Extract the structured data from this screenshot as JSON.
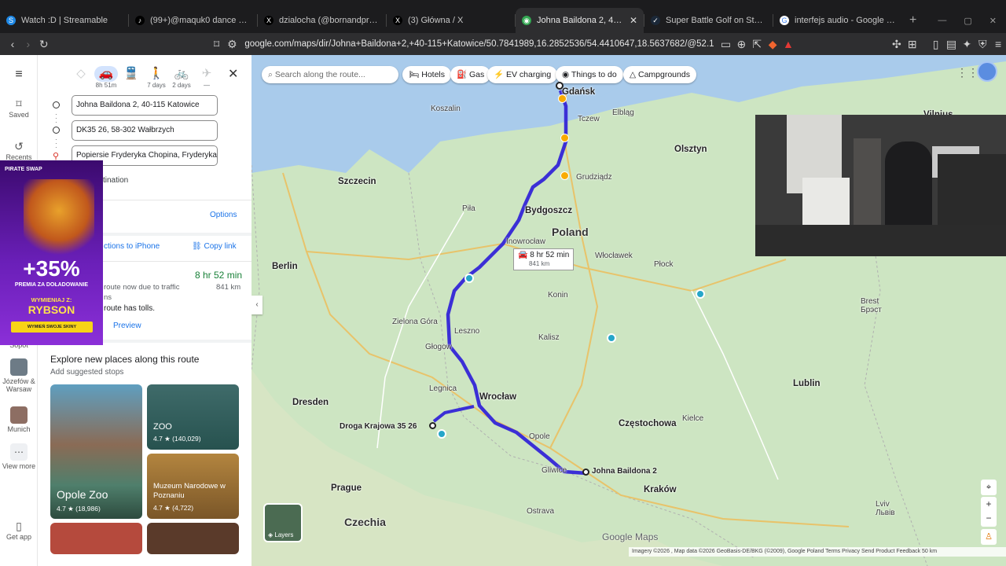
{
  "tabs": [
    {
      "label": "Watch :D | Streamable",
      "fav": "S",
      "color": "#1e88e5"
    },
    {
      "label": "(99+)@maquk0 dance #cortisol #hig",
      "fav": "♪",
      "color": "#000000"
    },
    {
      "label": "dzialocha (@bornandproud2011) / X",
      "fav": "X",
      "color": "#000000"
    },
    {
      "label": "(3) Główna / X",
      "fav": "X",
      "color": "#000000"
    },
    {
      "label": "Johna Baildona 2, 40-115 Katow",
      "fav": "◉",
      "color": "#34a853",
      "active": true
    },
    {
      "label": "Super Battle Golf on Steam",
      "fav": "✓",
      "color": "#1b2838"
    },
    {
      "label": "interfejs audio - Google Search",
      "fav": "G",
      "color": "#ffffff"
    }
  ],
  "url": "google.com/maps/dir/Johna+Baildona+2,+40-115+Katowice/50.7841989,16.2852536/54.4410647,18.5637682/@52.1240861,17.5229582,7.25z/...",
  "rail": {
    "saved": "Saved",
    "recents": "Recents",
    "sopot": "Sopot",
    "jozefow": "Józefów & Warsaw",
    "munich": "Munich",
    "view_more": "View more",
    "get_app": "Get app"
  },
  "modes": [
    {
      "icon": "◇",
      "label": ""
    },
    {
      "icon": "🚗",
      "label": "8h 51m",
      "selected": true
    },
    {
      "icon": "🚆",
      "label": ""
    },
    {
      "icon": "🚶",
      "label": "7 days"
    },
    {
      "icon": "🚲",
      "label": "2 days"
    },
    {
      "icon": "✈",
      "label": "—"
    }
  ],
  "waypoints": [
    "Johna Baildona 2, 40-115 Katowice",
    "DK35 26, 58-302 Wałbrzych",
    "Popiersie Fryderyka Chopina, Fryderyka"
  ],
  "add_destination": "tination",
  "options": "Options",
  "send_to_phone": "ctions to iPhone",
  "copy_link": "Copy link",
  "route": {
    "duration": "8 hr 52 min",
    "distance": "841 km",
    "note1": "route now due to traffic",
    "note2": "ns",
    "tolls": "route has tolls.",
    "preview": "Preview"
  },
  "explore": {
    "title": "Explore new places along this route",
    "subtitle": "Add suggested stops",
    "places": [
      {
        "name": "Opole Zoo",
        "rating": "4.7 ★ (18,986)"
      },
      {
        "name": "ZOO",
        "rating": "4.7 ★ (140,029)"
      },
      {
        "name": "Muzeum Narodowe w Poznaniu",
        "rating": "4.7 ★ (4,722)"
      }
    ]
  },
  "chips": {
    "search": "Search along the route...",
    "hotels": "Hotels",
    "gas": "Gas",
    "ev": "EV charging",
    "things": "Things to do",
    "camp": "Campgrounds"
  },
  "route_label": {
    "time": "8 hr 52 min",
    "dist": "841 km"
  },
  "map_labels": {
    "poland": "Poland",
    "czechia": "Czechia",
    "gdansk": "Gdańsk",
    "bydgoszcz": "Bydgoszcz",
    "szczecin": "Szczecin",
    "berlin": "Berlin",
    "wroclaw": "Wrocław",
    "dresden": "Dresden",
    "prague": "Prague",
    "czestochowa": "Częstochowa",
    "krakow": "Kraków",
    "lublin": "Lublin",
    "ostrava": "Ostrava",
    "katowice_dest": "Johna Baildona 2",
    "walbrzych_dest": "Droga Krajowa 35 26",
    "grudziadz": "Grudziądz",
    "inowroclaw": "Inowrocław",
    "leszno": "Leszno",
    "opole": "Opole",
    "kalisz": "Kalisz",
    "konin": "Konin",
    "plock": "Płock",
    "wloclawek": "Włocławek",
    "legnica": "Legnica",
    "glogow": "Głogow",
    "zielona": "Zielona Góra",
    "gliwice": "Gliwice",
    "kielce": "Kielce",
    "olsztyn": "Olsztyn",
    "elblag": "Elbląg",
    "tczew": "Tczew",
    "koszalin": "Koszalin",
    "pila": "Piła",
    "lviv": "Lviv\nЛьвів",
    "vilnius": "Vilnius",
    "brest": "Brest\nБрэст",
    "layers": "Layers",
    "google_maps": "Google Maps"
  },
  "attribution": "Imagery ©2026 , Map data ©2026 GeoBasis-DE/BKG (©2009), Google   Poland   Terms   Privacy   Send Product Feedback   50 km",
  "ad": {
    "brand": "PIRATE SWAP",
    "percent": "+35%",
    "line1": "PREMIA ZA DOŁADOWANIE",
    "line2": "WYMIENIAJ Z:",
    "code": "RYBSON",
    "cta": "WYMIEŃ SWOJE SKINY"
  },
  "colors": {
    "route": "#3b2fd6",
    "accent": "#1a73e8"
  }
}
